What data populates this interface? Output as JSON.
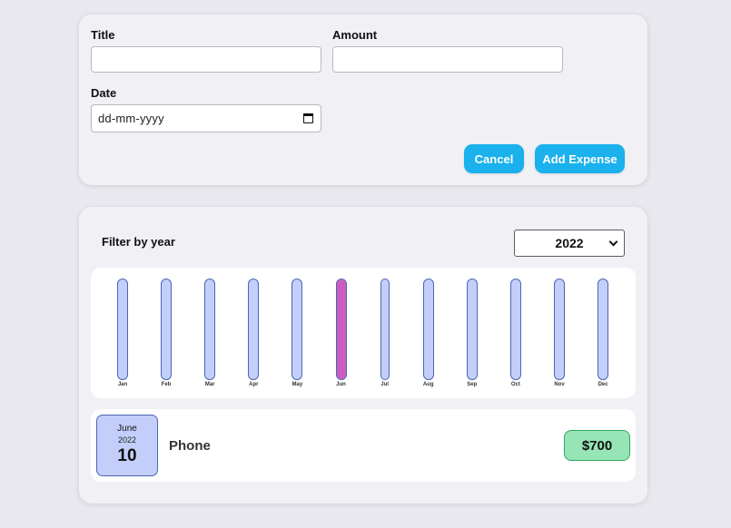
{
  "form": {
    "title_label": "Title",
    "title_value": "",
    "amount_label": "Amount",
    "amount_value": "",
    "date_label": "Date",
    "date_placeholder": "dd-mm-yyyy",
    "cancel_label": "Cancel",
    "add_label": "Add Expense"
  },
  "filter": {
    "label": "Filter by year",
    "selected_year": "2022"
  },
  "chart_data": {
    "type": "bar",
    "categories": [
      "Jan",
      "Feb",
      "Mar",
      "Apr",
      "May",
      "Jun",
      "Jul",
      "Aug",
      "Sep",
      "Oct",
      "Nov",
      "Dec"
    ],
    "values": [
      0,
      0,
      0,
      0,
      0,
      700,
      0,
      0,
      0,
      0,
      0,
      0
    ],
    "max_value": 700,
    "colors": {
      "track": "#c3cffa",
      "fill": "#cc5cc0",
      "border": "#4b66b3"
    }
  },
  "expenses": [
    {
      "month": "June",
      "year": "2022",
      "day": "10",
      "title": "Phone",
      "amount": "$700"
    }
  ],
  "colors": {
    "accent": "#1ab1ec",
    "price_bg": "#97e5b7",
    "badge_bg": "#c3cffa"
  }
}
